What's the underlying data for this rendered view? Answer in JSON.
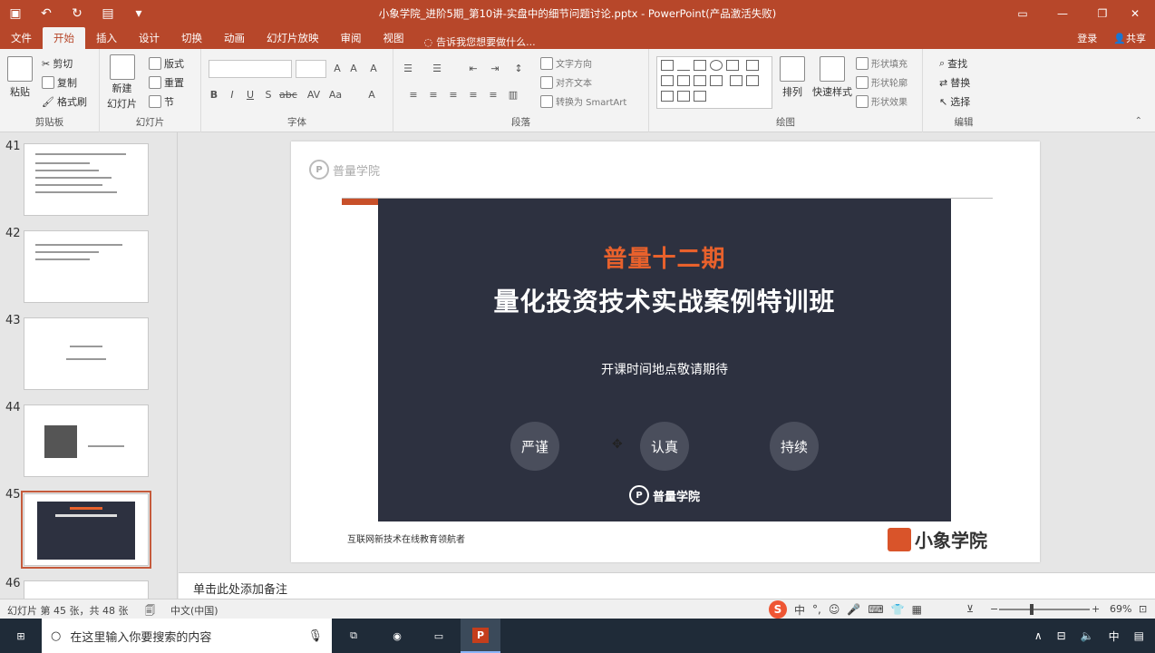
{
  "window": {
    "title": "小象学院_进阶5期_第10讲-实盘中的细节问题讨论.pptx - PowerPoint(产品激活失败)",
    "quick_access": [
      "save-icon",
      "undo-icon",
      "redo-icon",
      "present-icon",
      "dropdown-icon"
    ]
  },
  "tabs": {
    "items": [
      "文件",
      "开始",
      "插入",
      "设计",
      "切换",
      "动画",
      "幻灯片放映",
      "审阅",
      "视图"
    ],
    "active": "开始",
    "tell_me": "告诉我您想要做什么...",
    "login": "登录",
    "share": "共享"
  },
  "ribbon": {
    "clipboard": {
      "label": "剪贴板",
      "paste": "粘贴",
      "cut": "剪切",
      "copy": "复制",
      "format_painter": "格式刷"
    },
    "slides": {
      "label": "幻灯片",
      "new_slide": "新建",
      "new_slide2": "幻灯片",
      "layout": "版式",
      "reset": "重置",
      "section": "节"
    },
    "font": {
      "label": "字体"
    },
    "paragraph": {
      "label": "段落",
      "text_direction": "文字方向",
      "align_text": "对齐文本",
      "smartart": "转换为 SmartArt"
    },
    "drawing": {
      "label": "绘图",
      "arrange": "排列",
      "quick_styles": "快速样式",
      "shape_fill": "形状填充",
      "shape_outline": "形状轮廓",
      "shape_effects": "形状效果"
    },
    "editing": {
      "label": "编辑",
      "find": "查找",
      "replace": "替换",
      "select": "选择"
    }
  },
  "thumbnails": [
    {
      "num": "41",
      "selected": false,
      "kind": "text"
    },
    {
      "num": "42",
      "selected": false,
      "kind": "text"
    },
    {
      "num": "43",
      "selected": false,
      "kind": "title"
    },
    {
      "num": "44",
      "selected": false,
      "kind": "qr"
    },
    {
      "num": "45",
      "selected": true,
      "kind": "dark"
    },
    {
      "num": "46",
      "selected": false,
      "kind": "text"
    }
  ],
  "slide": {
    "top_logo": "普量学院",
    "headline_small": "普量十二期",
    "headline_big": "量化投资技术实战案例特训班",
    "subline": "开课时间地点敬请期待",
    "badges": [
      "严谨",
      "认真",
      "持续"
    ],
    "panel_logo": "普量学院",
    "footer_text": "互联网新技术在线教育领航者",
    "footer_brand": "小象学院"
  },
  "notes": {
    "placeholder": "单击此处添加备注"
  },
  "status": {
    "slide_info": "幻灯片 第 45 张，共 48 张",
    "language": "中文(中国)",
    "ime_letter": "S",
    "ime_mode": "中",
    "zoom": "69%",
    "zoom_fraction": 0.69
  },
  "taskbar": {
    "search_placeholder": "在这里输入你要搜索的内容",
    "ime": "中"
  }
}
